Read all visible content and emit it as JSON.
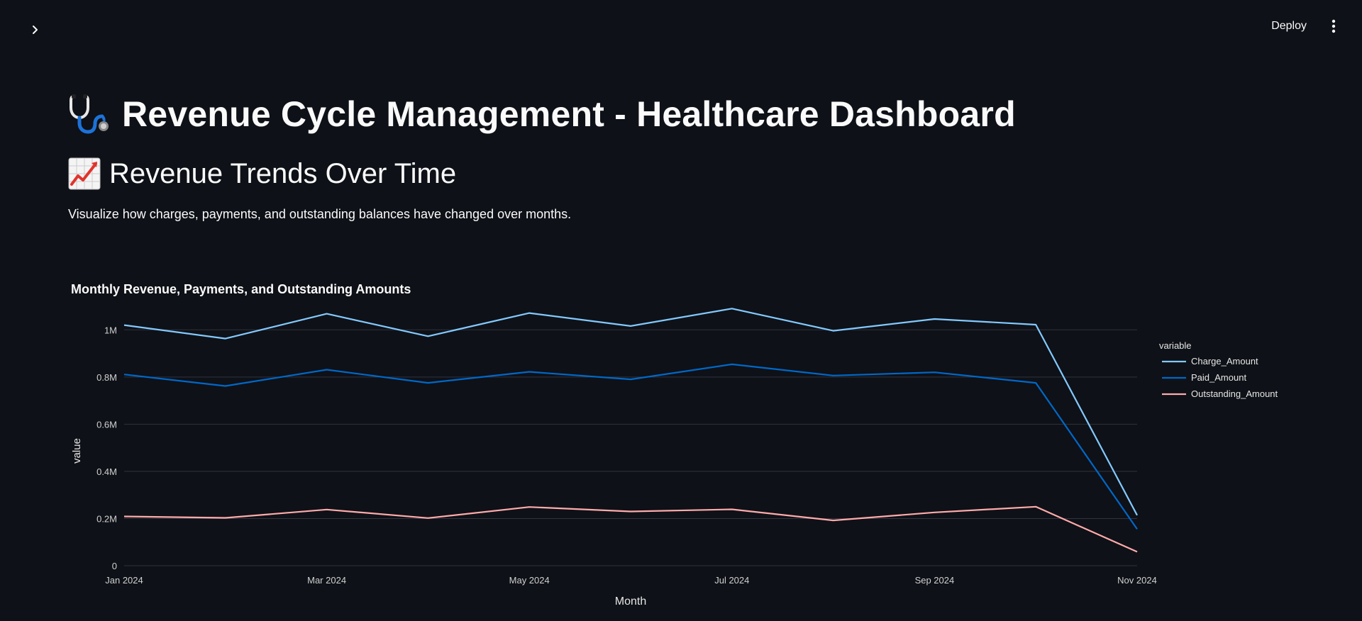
{
  "topbar": {
    "deploy_label": "Deploy"
  },
  "header": {
    "title": "Revenue Cycle Management - Healthcare Dashboard",
    "icon": "stethoscope-icon"
  },
  "section": {
    "title": "Revenue Trends Over Time",
    "icon": "chart-increasing-icon",
    "description": "Visualize how charges, payments, and outstanding balances have changed over months."
  },
  "colors": {
    "background": "#0e1117",
    "charge": "#83c9ff",
    "paid": "#0068c9",
    "outstanding": "#ffabab",
    "grid": "#31333f"
  },
  "chart_data": {
    "type": "line",
    "title": "Monthly Revenue, Payments, and Outstanding Amounts",
    "xlabel": "Month",
    "ylabel": "value",
    "x": [
      "2024-01",
      "2024-02",
      "2024-03",
      "2024-04",
      "2024-05",
      "2024-06",
      "2024-07",
      "2024-08",
      "2024-09",
      "2024-10",
      "2024-11"
    ],
    "x_tick_labels": [
      "Jan 2024",
      "Mar 2024",
      "May 2024",
      "Jul 2024",
      "Sep 2024",
      "Nov 2024"
    ],
    "y_ticks": [
      0,
      200000,
      400000,
      600000,
      800000,
      1000000
    ],
    "y_tick_labels": [
      "0",
      "0.2M",
      "0.4M",
      "0.6M",
      "0.8M",
      "1M"
    ],
    "ylim": [
      0,
      1100000
    ],
    "grid": true,
    "legend_title": "variable",
    "legend_position": "right",
    "series": [
      {
        "name": "Charge_Amount",
        "color": "#83c9ff",
        "values": [
          1020000,
          963000,
          1068000,
          973000,
          1071000,
          1016000,
          1090000,
          996000,
          1046000,
          1022000,
          214000
        ]
      },
      {
        "name": "Paid_Amount",
        "color": "#0068c9",
        "values": [
          811000,
          762000,
          831000,
          775000,
          822000,
          790000,
          854000,
          806000,
          820000,
          775000,
          155000
        ]
      },
      {
        "name": "Outstanding_Amount",
        "color": "#ffabab",
        "values": [
          209000,
          203000,
          238000,
          202000,
          249000,
          230000,
          239000,
          192000,
          226000,
          250000,
          59000
        ]
      }
    ]
  }
}
